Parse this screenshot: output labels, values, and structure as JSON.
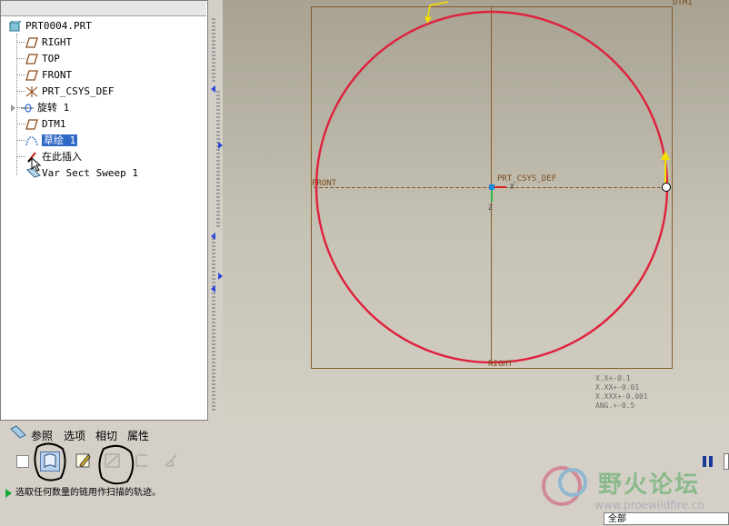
{
  "model_tree": {
    "root": "PRT0004.PRT",
    "items": [
      {
        "label": "RIGHT",
        "icon": "datum-plane-icon"
      },
      {
        "label": "TOP",
        "icon": "datum-plane-icon"
      },
      {
        "label": "FRONT",
        "icon": "datum-plane-icon"
      },
      {
        "label": "PRT_CSYS_DEF",
        "icon": "csys-icon"
      },
      {
        "label": "旋转 1",
        "icon": "revolve-icon"
      },
      {
        "label": "DTM1",
        "icon": "datum-plane-icon"
      },
      {
        "label": "草绘 1",
        "icon": "sketch-icon",
        "selected": true
      },
      {
        "label": "在此插入",
        "icon": "insert-here-icon"
      },
      {
        "label": "Var Sect Sweep 1",
        "icon": "var-sect-sweep-icon"
      }
    ]
  },
  "graphics": {
    "labels": {
      "dtm1": "DTM1",
      "front": "FRONT",
      "csys": "PRT_CSYS_DEF",
      "right": "RIGHT",
      "x_axis": "X",
      "z_axis": "Z"
    },
    "tolerances": [
      "X.X+-0.1",
      "X.XX+-0.01",
      "X.XXX+-0.001",
      "ANG.+-0.5"
    ],
    "colors": {
      "trajectory": "#e0203c",
      "datum": "#7a4a1a"
    }
  },
  "dashboard": {
    "tabs": [
      "参照",
      "选项",
      "相切",
      "属性"
    ],
    "status_message": "选取任何数量的链用作扫描的轨迹。",
    "filter_value": "全部"
  },
  "watermark": {
    "title": "野火论坛",
    "url": "www.proewildfire.cn"
  }
}
